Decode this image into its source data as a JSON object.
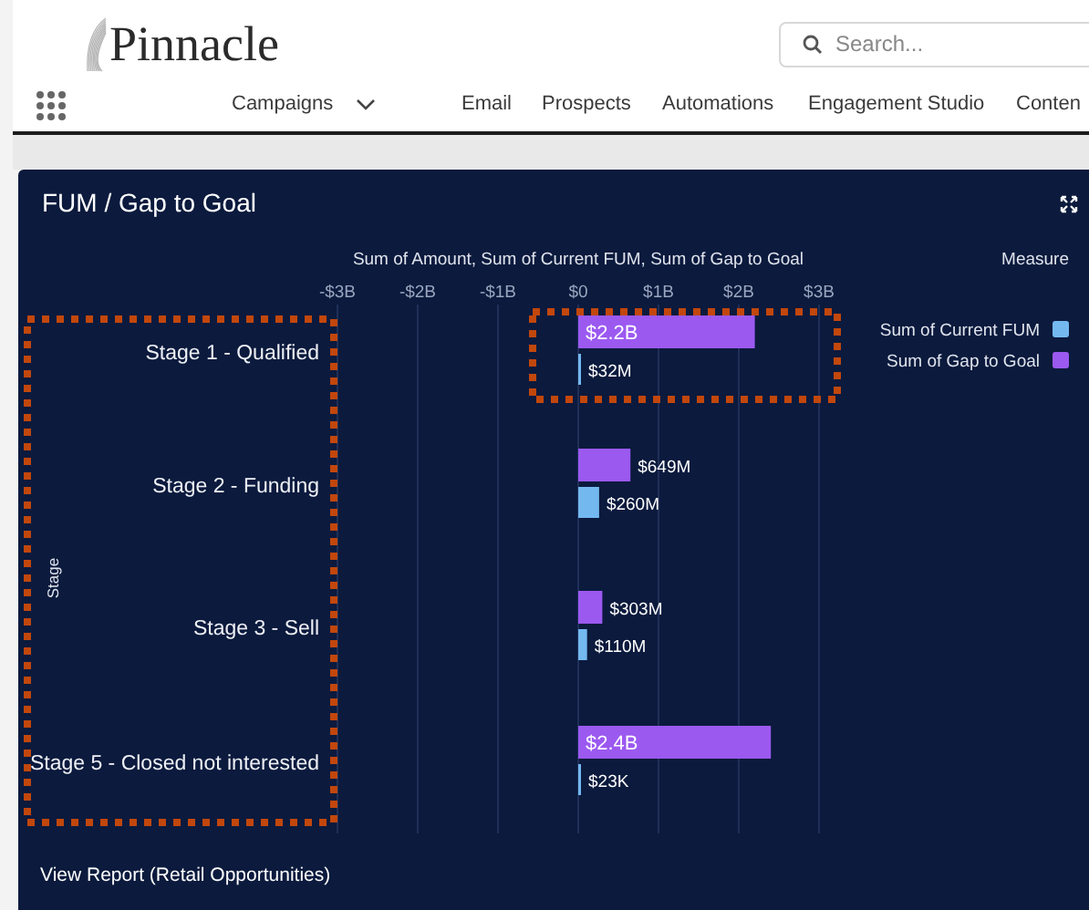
{
  "header": {
    "logo": "Pinnacle",
    "search": {
      "placeholder": "Search..."
    }
  },
  "nav": [
    {
      "label": "Campaigns",
      "has_menu": true
    },
    {
      "label": "Email",
      "has_menu": false
    },
    {
      "label": "Prospects",
      "has_menu": false
    },
    {
      "label": "Automations",
      "has_menu": false
    },
    {
      "label": "Engagement Studio",
      "has_menu": false
    },
    {
      "label": "Conten",
      "has_menu": false
    }
  ],
  "panel": {
    "title": "FUM / Gap to Goal",
    "link": "View Report (Retail Opportunities)",
    "chart_data": {
      "type": "bar",
      "orientation": "horizontal",
      "title": "Sum of Amount, Sum of Current FUM, Sum of Gap to Goal",
      "ylabel": "Stage",
      "legend_title": "Measure",
      "categories": [
        "Stage 1 - Qualified",
        "Stage 2 - Funding",
        "Stage 3 - Sell",
        "Stage 5 - Closed not interested"
      ],
      "series": [
        {
          "name": "Sum of Current FUM",
          "color": "#74b8f0",
          "values": [
            0.03,
            0.26,
            0.11,
            0
          ]
        },
        {
          "name": "Sum of Gap to Goal",
          "color": "#9b59f0",
          "values": [
            2.2,
            0.65,
            0.3,
            2.4
          ]
        }
      ],
      "grid": true,
      "legend": true,
      "value_labels": [
        [
          "$32M",
          "$260M",
          "$110M",
          "$23K"
        ],
        [
          "$2.2B",
          "$649M",
          "$303M",
          "$2.4B"
        ]
      ],
      "xlim": [
        -3,
        3
      ],
      "xticks": [
        {
          "value": -3,
          "label": "-$3B"
        },
        {
          "value": -2,
          "label": "-$2B"
        },
        {
          "value": -1,
          "label": "-$1B"
        },
        {
          "value": 0,
          "label": "$0"
        },
        {
          "value": 1,
          "label": "$1B"
        },
        {
          "value": 2,
          "label": "$2B"
        },
        {
          "value": 3,
          "label": "$3B"
        }
      ]
    }
  }
}
